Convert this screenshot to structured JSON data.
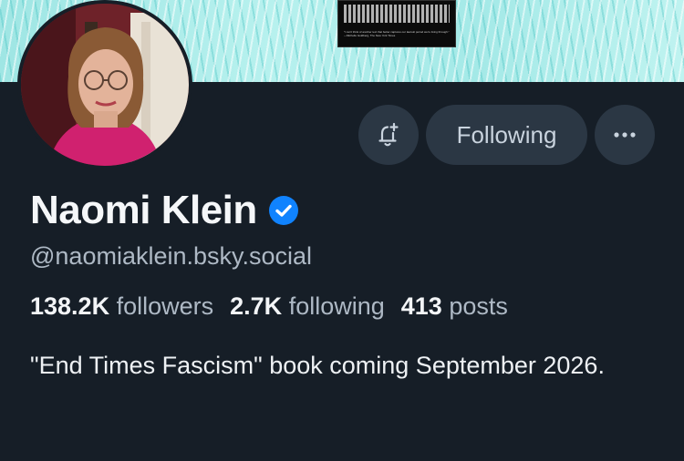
{
  "banner": {
    "book_quote": "\"I can't think of another text that better captures our lawsuit period we're living through.\" —Michelle Goldberg, The New York Times"
  },
  "profile": {
    "display_name": "Naomi Klein",
    "handle": "@naomiaklein.bsky.social",
    "verified": true,
    "bio": "\"End Times Fascism\" book coming September 2026."
  },
  "stats": {
    "followers_count": "138.2K",
    "followers_label": "followers",
    "following_count": "2.7K",
    "following_label": "following",
    "posts_count": "413",
    "posts_label": "posts"
  },
  "actions": {
    "subscribe_icon": "bell-plus-icon",
    "following_label": "Following",
    "more_icon": "ellipsis-icon"
  },
  "colors": {
    "background": "#161e27",
    "button_bg": "#2b3744",
    "verified_blue": "#1083fe",
    "banner_teal": "#a9ece9"
  }
}
